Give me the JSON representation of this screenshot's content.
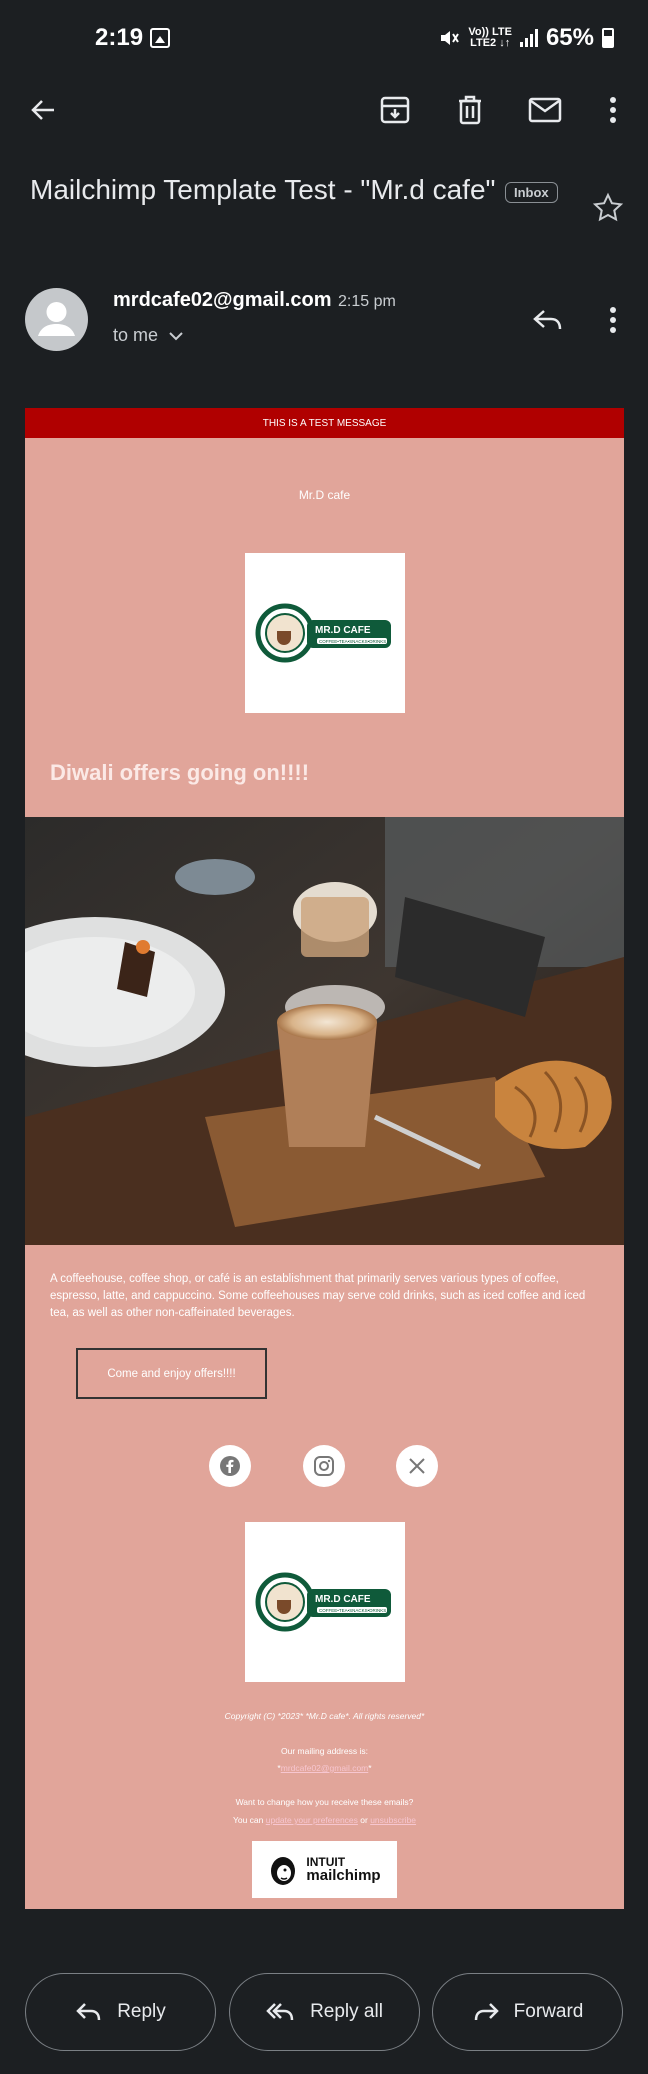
{
  "status_bar": {
    "time": "2:19",
    "network_top": "Vo)) LTE",
    "network_bottom": "LTE2 ↓↑",
    "battery": "65%"
  },
  "toolbar": {
    "icons": [
      "back-arrow-icon",
      "archive-icon",
      "delete-icon",
      "mark-unread-icon",
      "more-vert-icon"
    ]
  },
  "email": {
    "subject": "Mailchimp Template Test - \"Mr.d cafe\"",
    "label": "Inbox",
    "sender": "mrdcafe02@gmail.com",
    "time": "2:15 pm",
    "recipient": "to me"
  },
  "template": {
    "banner": "THIS IS A TEST MESSAGE",
    "brand_name": "Mr.D cafe",
    "logo_title": "MR.D CAFE",
    "logo_subtitle": "COFFEE•TEA•SNACKS•DRINKS",
    "headline": "Diwali offers going on!!!!",
    "body": "A coffeehouse, coffee shop, or café is an establishment that primarily serves various types of coffee, espresso, latte, and cappuccino. Some coffeehouses may serve cold drinks, such as iced coffee and iced tea, as well as other non-caffeinated beverages.",
    "cta_label": "Come and enjoy offers!!!!",
    "social": [
      "facebook-icon",
      "instagram-icon",
      "x-icon"
    ],
    "copyright": "Copyright (C) *2023* *Mr.D cafe*. All rights reserved*",
    "mailing_label": "Our mailing address is:",
    "mailing_prefix": "*",
    "mailing_email": "mrdcafe02@gmail.com",
    "mailing_suffix": "*",
    "change_text": "Want to change how you receive these emails?",
    "you_can": "You can ",
    "update_link": "update your preferences",
    "or": " or ",
    "unsubscribe_link": "unsubscribe",
    "mc_line1": "INTUIT",
    "mc_line2": "mailchimp"
  },
  "actions": {
    "reply": "Reply",
    "reply_all": "Reply all",
    "forward": "Forward"
  },
  "colors": {
    "background": "#1c1f22",
    "card": "#e1a59a",
    "banner": "#b00000",
    "logo_green": "#0f5a3a"
  }
}
